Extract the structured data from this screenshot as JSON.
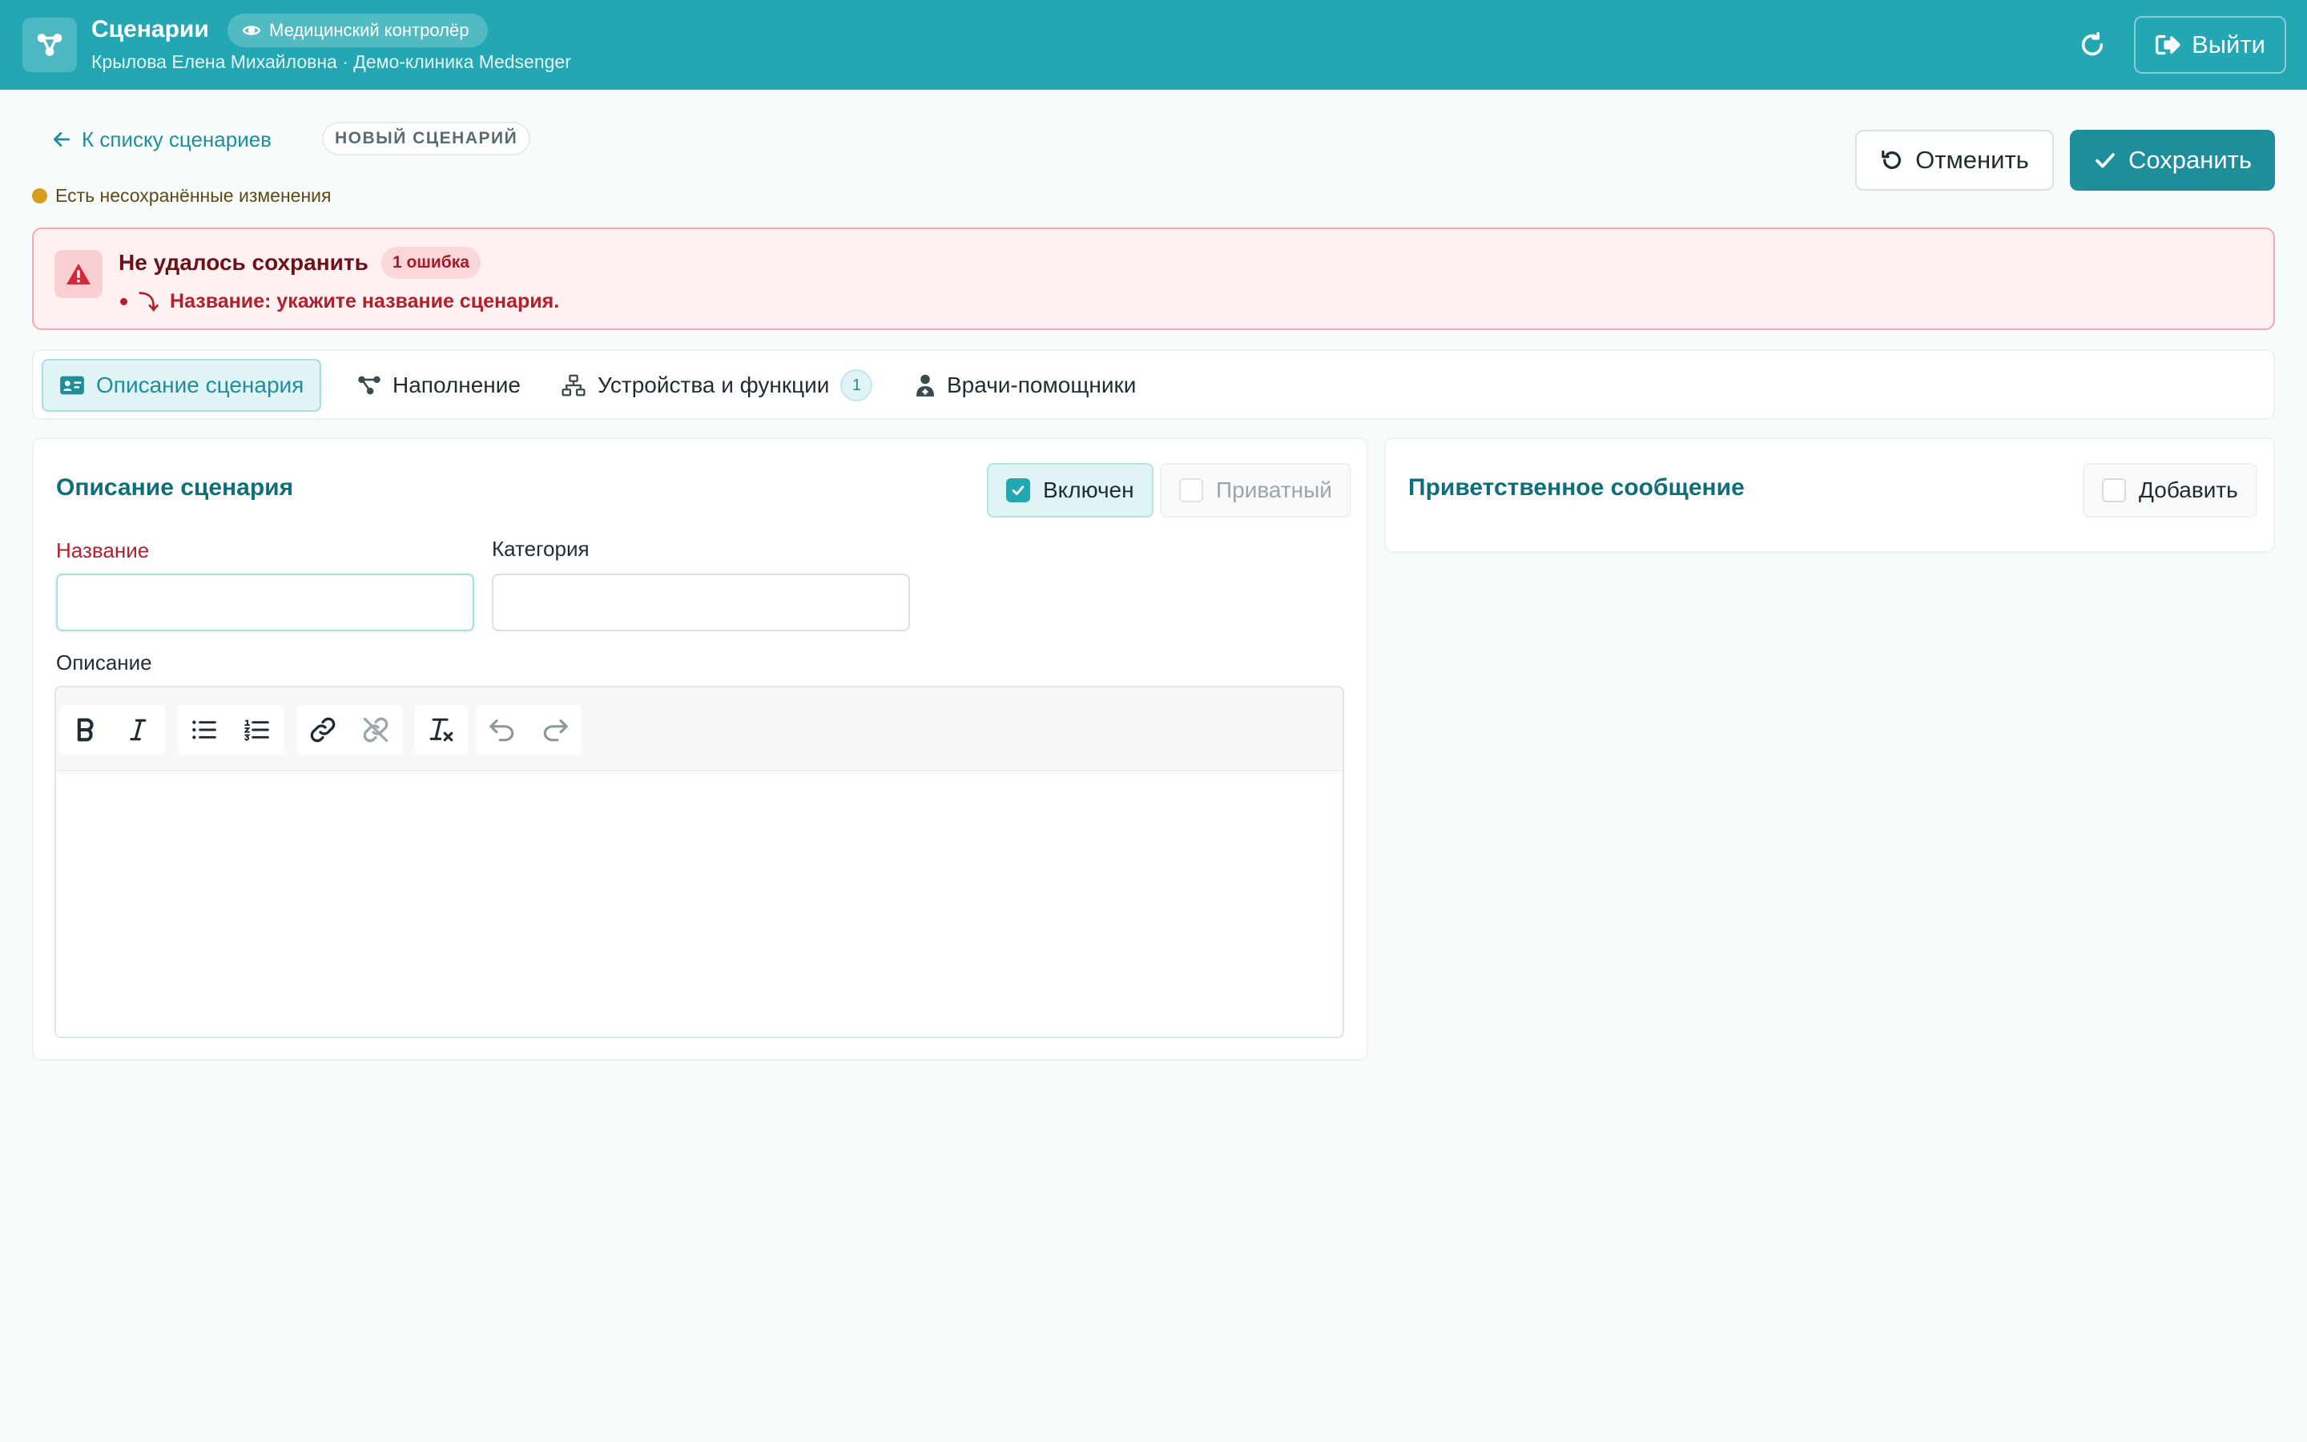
{
  "header": {
    "title": "Сценарии",
    "role_badge": "Медицинский контролёр",
    "user_line": "Крылова Елена Михайловна · Демо-клиника Medsenger",
    "logout_label": "Выйти"
  },
  "subheader": {
    "back_label": "К списку сценариев",
    "new_badge": "НОВЫЙ СЦЕНАРИЙ",
    "unsaved_text": "Есть несохранённые изменения",
    "cancel_label": "Отменить",
    "save_label": "Сохранить"
  },
  "error": {
    "title": "Не удалось сохранить",
    "count_label": "1 ошибка",
    "items": [
      {
        "arrow": "⤵",
        "text": "Название: укажите название сценария."
      }
    ]
  },
  "tabs": [
    {
      "label": "Описание сценария",
      "active": true
    },
    {
      "label": "Наполнение"
    },
    {
      "label": "Устройства и функции",
      "count": "1"
    },
    {
      "label": "Врачи-помощники"
    }
  ],
  "description_panel": {
    "title": "Описание сценария",
    "enabled_label": "Включен",
    "enabled_checked": true,
    "private_label": "Приватный",
    "private_checked": false,
    "name_label": "Название",
    "name_value": "",
    "category_label": "Категория",
    "category_value": "",
    "description_label": "Описание",
    "description_value": ""
  },
  "toolbar_icons": [
    "bold-icon",
    "italic-icon",
    "bullet-list-icon",
    "numbered-list-icon",
    "link-icon",
    "unlink-icon",
    "clear-format-icon",
    "undo-icon",
    "redo-icon"
  ],
  "welcome_panel": {
    "title": "Приветственное сообщение",
    "add_label": "Добавить",
    "add_checked": false
  },
  "colors": {
    "brand": "#22a7b3",
    "accent": "#1e8e9b",
    "error": "#b3202d",
    "warning_dot": "#d69e1e"
  }
}
